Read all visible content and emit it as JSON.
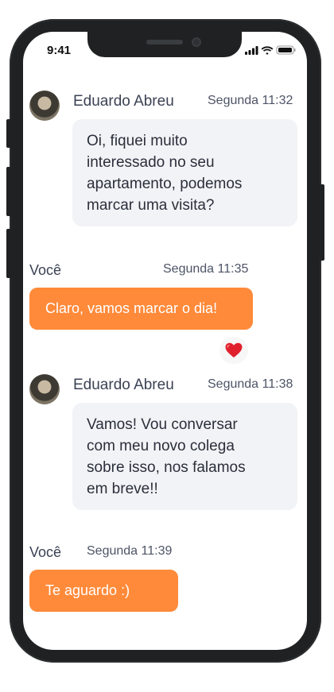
{
  "status_bar": {
    "time": "9:41"
  },
  "messages": [
    {
      "sender": "Eduardo Abreu",
      "time": "Segunda 11:32",
      "text_lines": [
        "Oi, fiquei muito",
        "interessado no seu",
        "apartamento, podemos",
        "marcar uma visita?"
      ]
    },
    {
      "sender": "Você",
      "time": "Segunda 11:35",
      "text": "Claro, vamos marcar o dia!",
      "reaction": "❤️"
    },
    {
      "sender": "Eduardo Abreu",
      "time": "Segunda 11:38",
      "text_lines": [
        "Vamos! Vou conversar",
        "com meu novo colega",
        "sobre isso, nos falamos",
        "em breve!!"
      ]
    },
    {
      "sender": "Você",
      "time": "Segunda 11:39",
      "text": "Te aguardo :)"
    }
  ],
  "colors": {
    "outgoing_bubble": "#ff8a3a",
    "incoming_bubble": "#f2f3f6",
    "frame": "#1f2122"
  }
}
